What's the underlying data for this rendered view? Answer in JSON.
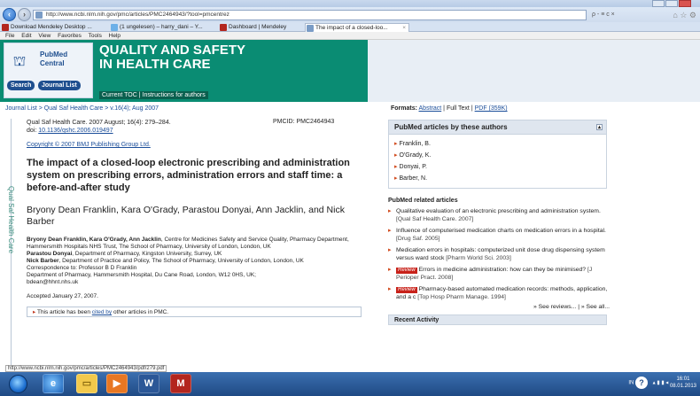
{
  "browser": {
    "url": "http://www.ncbi.nlm.nih.gov/pmc/articles/PMC2464943/?tool=pmcentrez",
    "tabs": [
      {
        "label": "Download Mendeley Desktop ..."
      },
      {
        "label": "(1 ungelesen) – harry_dani – Y..."
      },
      {
        "label": "Dashboard | Mendeley"
      },
      {
        "label": "The impact of a closed-loo..."
      }
    ],
    "menu": [
      "File",
      "Edit",
      "View",
      "Favorites",
      "Tools",
      "Help"
    ],
    "search_tools": "ρ - ≡ c ×"
  },
  "banner": {
    "pmc_line1": "PubMed",
    "pmc_line2": "Central",
    "search_btn": "Search",
    "journal_list_btn": "Journal List",
    "journal_title_line1": "QUALITY AND SAFETY",
    "journal_title_line2": "IN HEALTH CARE",
    "links": "Current TOC | Instructions for authors"
  },
  "breadcrumb": "Journal List > Qual Saf Health Care > v.16(4); Aug 2007",
  "formats": {
    "label": "Formats:",
    "abstract": "Abstract",
    "sep1": "|",
    "fulltext": "Full Text",
    "sep2": "|",
    "pdf": "PDF (359K)"
  },
  "side_label": "Qual Saf Health Care",
  "article": {
    "citation": "Qual Saf Health Care. 2007 August; 16(4): 279–284.",
    "pmcid": "PMCID: PMC2464943",
    "doi_label": "doi:",
    "doi": "10.1136/qshc.2006.019497",
    "copyright": "Copyright © 2007 BMJ Publishing Group Ltd.",
    "title": "The impact of a closed-loop electronic prescribing and administration system on prescribing errors, administration errors and staff time: a before-and-after study",
    "authors": "Bryony Dean Franklin, Kara O'Grady, Parastou Donyai, Ann Jacklin, and Nick Barber",
    "affil1_names": "Bryony Dean Franklin, Kara O'Grady, Ann Jacklin",
    "affil1_text": ", Centre for Medicines Safety and Service Quality, Pharmacy Department, Hammersmith Hospitals NHS Trust, The School of Pharmacy, University of London, London, UK",
    "affil2_name": "Parastou Donyai",
    "affil2_text": ", Department of Pharmacy, Kingston University, Surrey, UK",
    "affil3_name": "Nick Barber",
    "affil3_text": ", Department of Practice and Policy, The School of Pharmacy, University of London, London, UK",
    "correspondence": "Correspondence to: Professor B D Franklin",
    "address": "Department of Pharmacy, Hammersmith Hospital, Du Cane Road, London, W12 0HS, UK;",
    "email": "bdean@hhnt.nhs.uk",
    "accepted": "Accepted January 27, 2007.",
    "cited_prefix": "This article has been ",
    "cited_link": "cited by",
    "cited_suffix": " other articles in PMC."
  },
  "status_url": "http://www.ncbi.nlm.nih.gov/pmc/articles/PMC2464943/pdf/279.pdf",
  "sidebar": {
    "authors_panel_title": "PubMed articles by these authors",
    "authors": [
      "Franklin, B.",
      "O'Grady, K.",
      "Donyai, P.",
      "Barber, N."
    ],
    "related_title": "PubMed related articles",
    "related": [
      {
        "review": false,
        "text": "Qualitative evaluation of an electronic prescribing and administration system.",
        "source": "[Qual Saf Health Care. 2007]"
      },
      {
        "review": false,
        "text": "Influence of computerised medication charts on medication errors in a hospital.",
        "source": "[Drug Saf. 2005]"
      },
      {
        "review": false,
        "text": "Medication errors in hospitals: computerized unit dose drug dispensing system versus ward stock",
        "source": "[Pharm World Sci. 2003]"
      },
      {
        "review": true,
        "text": "Errors in medicine administration: how can they be minimised?",
        "source": "[J Perioper Pract. 2008]"
      },
      {
        "review": true,
        "text": "Pharmacy-based automated medication records: methods, application, and a c",
        "source": "[Top Hosp Pharm Manage. 1994]"
      }
    ],
    "review_label": "Review",
    "see_reviews": "» See reviews...",
    "see_sep": " | ",
    "see_all": "» See all...",
    "recent_title": "Recent Activity"
  },
  "taskbar": {
    "word_icon": "W",
    "mendeley_icon": "M",
    "lang": "IN",
    "time": "16:01",
    "date": "08.01.2013"
  }
}
